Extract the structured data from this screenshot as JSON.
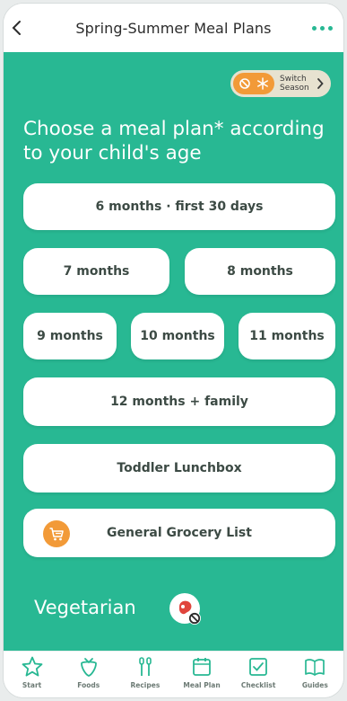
{
  "header": {
    "title": "Spring-Summer Meal Plans"
  },
  "switch_season": {
    "label": "Switch Season"
  },
  "heading": "Choose a meal plan* according to your child's age",
  "plans": {
    "six_months": "6 months · first 30 days",
    "seven_months": "7 months",
    "eight_months": "8 months",
    "nine_months": "9 months",
    "ten_months": "10 months",
    "eleven_months": "11 months",
    "twelve_months": "12 months + family",
    "toddler": "Toddler Lunchbox",
    "grocery": "General Grocery List"
  },
  "vegetarian": {
    "label": "Vegetarian"
  },
  "bottom_nav": {
    "items": [
      {
        "label": "Start",
        "icon": "star-icon"
      },
      {
        "label": "Foods",
        "icon": "strawberry-icon"
      },
      {
        "label": "Recipes",
        "icon": "utensils-icon"
      },
      {
        "label": "Meal Plan",
        "icon": "calendar-icon"
      },
      {
        "label": "Checklist",
        "icon": "checklist-icon"
      },
      {
        "label": "Guides",
        "icon": "book-icon"
      }
    ]
  },
  "colors": {
    "brand_green": "#28b893",
    "accent_orange": "#f29a38",
    "card_text": "#3c4a44"
  }
}
